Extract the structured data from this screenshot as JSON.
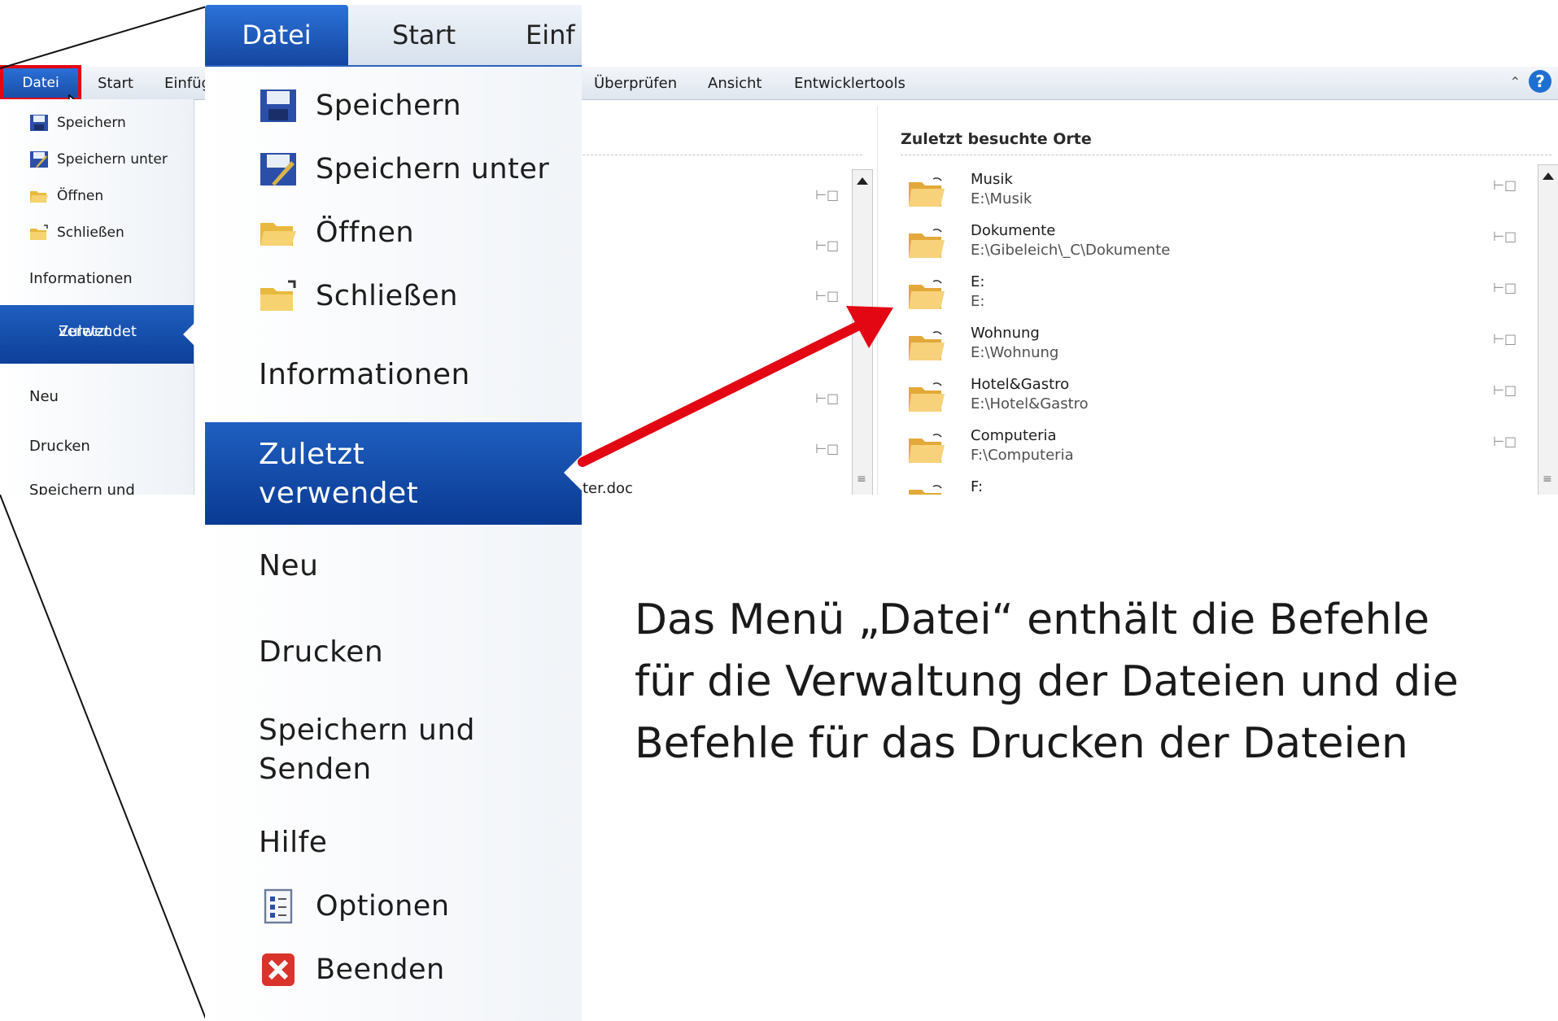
{
  "small": {
    "tabs": [
      "Datei",
      "Start",
      "Einfüg",
      "Überprüfen",
      "Ansicht",
      "Entwicklertools"
    ],
    "menu": {
      "save": "Speichern",
      "save_as": "Speichern unter",
      "open": "Öffnen",
      "close": "Schließen",
      "info": "Informationen",
      "recent_line1": "Zuletzt",
      "recent_line2": "verwendet",
      "new": "Neu",
      "print": "Drucken",
      "save_send": "Speichern und"
    },
    "doc_fragment": "ter.doc",
    "help": "?",
    "places": {
      "title": "Zuletzt besuchte Orte",
      "items": [
        {
          "name": "Musik",
          "path": "E:\\Musik"
        },
        {
          "name": "Dokumente",
          "path": "E:\\Gibeleich\\_C\\Dokumente"
        },
        {
          "name": "E:",
          "path": "E:"
        },
        {
          "name": "Wohnung",
          "path": "E:\\Wohnung"
        },
        {
          "name": "Hotel&Gastro",
          "path": "E:\\Hotel&Gastro"
        },
        {
          "name": "Computeria",
          "path": "F:\\Computeria"
        },
        {
          "name": "F:",
          "path": ""
        }
      ]
    }
  },
  "zoom": {
    "tabs": [
      "Datei",
      "Start",
      "Einf"
    ],
    "menu": {
      "save": "Speichern",
      "save_as": "Speichern unter",
      "open": "Öffnen",
      "close": "Schließen",
      "info": "Informationen",
      "recent_line1": "Zuletzt",
      "recent_line2": "verwendet",
      "new": "Neu",
      "print": "Drucken",
      "save_send_line1": "Speichern und",
      "save_send_line2": "Senden",
      "help": "Hilfe",
      "options": "Optionen",
      "exit": "Beenden"
    }
  },
  "caption": {
    "line1": "Das Menü „Datei“ enthält die Befehle",
    "line2": "für die Verwaltung der Dateien und die",
    "line3": "Befehle für das Drucken der Dateien"
  },
  "colors": {
    "accent_blue": "#1a56b8",
    "highlight_red": "#e30613",
    "folder_yellow": "#f2c14e"
  }
}
